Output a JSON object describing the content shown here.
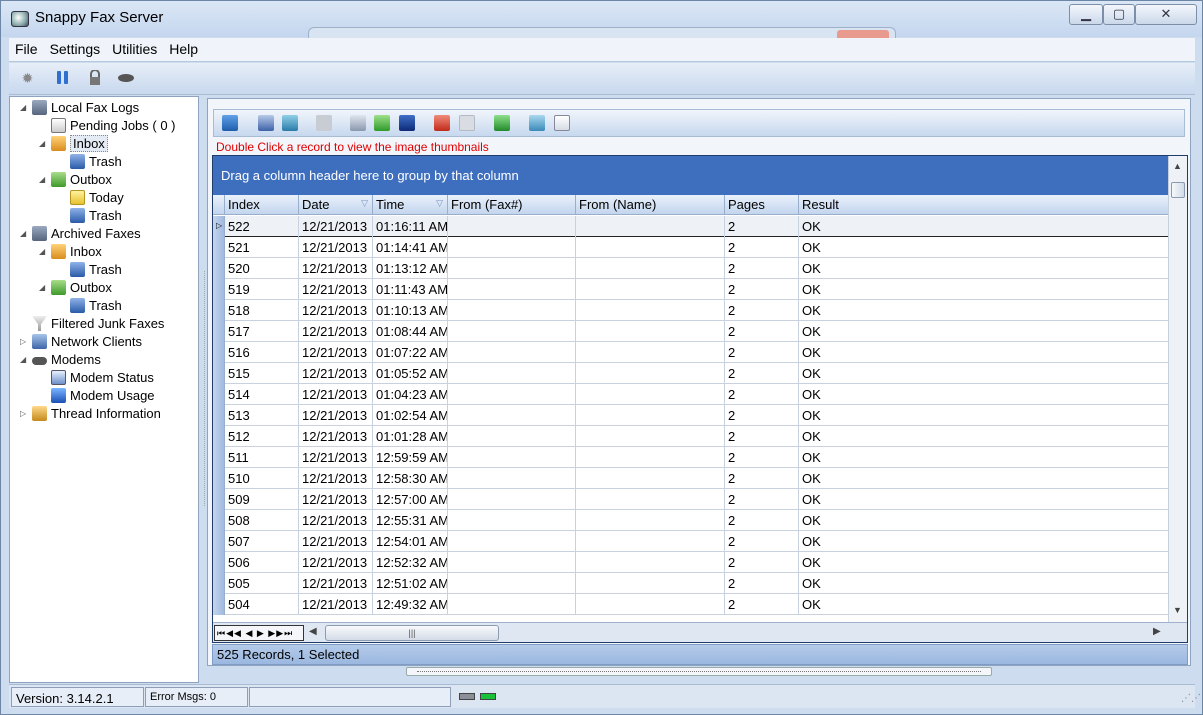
{
  "window": {
    "title": "Snappy Fax Server"
  },
  "menu": [
    "File",
    "Settings",
    "Utilities",
    "Help"
  ],
  "toolbar_icons": [
    "gear-icon",
    "pause-icon",
    "lock-icon",
    "modem-icon"
  ],
  "tree": [
    {
      "label": "Local Fax Logs",
      "level": 0,
      "exp": "◢",
      "icon": "log"
    },
    {
      "label": "Pending Jobs ( 0 )",
      "level": 1,
      "exp": "",
      "icon": "jobs"
    },
    {
      "label": "Inbox",
      "level": 1,
      "exp": "◢",
      "icon": "inbox",
      "selected": true
    },
    {
      "label": "Trash",
      "level": 2,
      "exp": "",
      "icon": "trash"
    },
    {
      "label": "Outbox",
      "level": 1,
      "exp": "◢",
      "icon": "outbox"
    },
    {
      "label": "Today",
      "level": 2,
      "exp": "",
      "icon": "folder"
    },
    {
      "label": "Trash",
      "level": 2,
      "exp": "",
      "icon": "trash"
    },
    {
      "label": "Archived Faxes",
      "level": 0,
      "exp": "◢",
      "icon": "log"
    },
    {
      "label": "Inbox",
      "level": 1,
      "exp": "◢",
      "icon": "inbox"
    },
    {
      "label": "Trash",
      "level": 2,
      "exp": "",
      "icon": "trash"
    },
    {
      "label": "Outbox",
      "level": 1,
      "exp": "◢",
      "icon": "outbox"
    },
    {
      "label": "Trash",
      "level": 2,
      "exp": "",
      "icon": "trash"
    },
    {
      "label": "Filtered Junk Faxes",
      "level": 0,
      "exp": "",
      "icon": "filter"
    },
    {
      "label": "Network Clients",
      "level": 0,
      "exp": "▷",
      "icon": "net"
    },
    {
      "label": "Modems",
      "level": 0,
      "exp": "◢",
      "icon": "modem"
    },
    {
      "label": "Modem  Status",
      "level": 1,
      "exp": "",
      "icon": "status"
    },
    {
      "label": "Modem  Usage",
      "level": 1,
      "exp": "",
      "icon": "usage"
    },
    {
      "label": "Thread Information",
      "level": 0,
      "exp": "▷",
      "icon": "thread"
    }
  ],
  "hint": "Double Click a record to view the image thumbnails",
  "group_hint": "Drag a column header here to group by that column",
  "columns": [
    "Index",
    "Date",
    "Time",
    "From (Fax#)",
    "From (Name)",
    "Pages",
    "Result"
  ],
  "rows": [
    [
      "522",
      "12/21/2013",
      "01:16:11 AM",
      "",
      "",
      "2",
      "OK"
    ],
    [
      "521",
      "12/21/2013",
      "01:14:41 AM",
      "",
      "",
      "2",
      "OK"
    ],
    [
      "520",
      "12/21/2013",
      "01:13:12 AM",
      "",
      "",
      "2",
      "OK"
    ],
    [
      "519",
      "12/21/2013",
      "01:11:43 AM",
      "",
      "",
      "2",
      "OK"
    ],
    [
      "518",
      "12/21/2013",
      "01:10:13 AM",
      "",
      "",
      "2",
      "OK"
    ],
    [
      "517",
      "12/21/2013",
      "01:08:44 AM",
      "",
      "",
      "2",
      "OK"
    ],
    [
      "516",
      "12/21/2013",
      "01:07:22 AM",
      "",
      "",
      "2",
      "OK"
    ],
    [
      "515",
      "12/21/2013",
      "01:05:52 AM",
      "",
      "",
      "2",
      "OK"
    ],
    [
      "514",
      "12/21/2013",
      "01:04:23 AM",
      "",
      "",
      "2",
      "OK"
    ],
    [
      "513",
      "12/21/2013",
      "01:02:54 AM",
      "",
      "",
      "2",
      "OK"
    ],
    [
      "512",
      "12/21/2013",
      "01:01:28 AM",
      "",
      "",
      "2",
      "OK"
    ],
    [
      "511",
      "12/21/2013",
      "12:59:59 AM",
      "",
      "",
      "2",
      "OK"
    ],
    [
      "510",
      "12/21/2013",
      "12:58:30 AM",
      "",
      "",
      "2",
      "OK"
    ],
    [
      "509",
      "12/21/2013",
      "12:57:00 AM",
      "",
      "",
      "2",
      "OK"
    ],
    [
      "508",
      "12/21/2013",
      "12:55:31 AM",
      "",
      "",
      "2",
      "OK"
    ],
    [
      "507",
      "12/21/2013",
      "12:54:01 AM",
      "",
      "",
      "2",
      "OK"
    ],
    [
      "506",
      "12/21/2013",
      "12:52:32 AM",
      "",
      "",
      "2",
      "OK"
    ],
    [
      "505",
      "12/21/2013",
      "12:51:02 AM",
      "",
      "",
      "2",
      "OK"
    ],
    [
      "504",
      "12/21/2013",
      "12:49:32 AM",
      "",
      "",
      "2",
      "OK"
    ]
  ],
  "record_status": "525 Records, 1 Selected",
  "status": {
    "version": "Version: 3.14.2.1",
    "errors": "Error Msgs: 0"
  }
}
